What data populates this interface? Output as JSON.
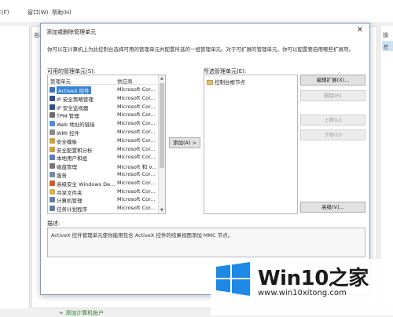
{
  "menubar": {
    "items": [
      "文件(F)",
      "操作(A)",
      "查看(V)",
      "收藏夹(O)",
      "窗口(W)",
      "帮助(H)"
    ]
  },
  "background": {
    "mid_label": "名称",
    "right_label": "操",
    "right_tab": "控",
    "bottom_link": "+ 添加计算机帐户"
  },
  "dialog": {
    "title": "添加或删除管理单元",
    "description": "你可以在计算机上为此控制台选择可用的管理单元并配置所选的一组管理单元。对于可扩展的管理单元，你可以配置要启用哪些扩展项。",
    "available_label": "可用的管理单元(S):",
    "selected_label": "所选管理单元(E):",
    "columns": {
      "name": "管理单元",
      "vendor": "供应商"
    },
    "snapins": [
      {
        "name": "ActiveX 控件",
        "vendor": "Microsoft Cor...",
        "icon_color": "#3a6fc4",
        "selected": true
      },
      {
        "name": "IP 安全策略管理",
        "vendor": "Microsoft Cor...",
        "icon_color": "#2f4f8a",
        "selected": false
      },
      {
        "name": "IP 安全监视器",
        "vendor": "Microsoft Cor...",
        "icon_color": "#2f4f8a",
        "selected": false
      },
      {
        "name": "TPM 管理",
        "vendor": "Microsoft Cor...",
        "icon_color": "#6b6b6b",
        "selected": false
      },
      {
        "name": "Web 地址的链接",
        "vendor": "Microsoft Cor...",
        "icon_color": "#4a90d9",
        "selected": false
      },
      {
        "name": "WMI 控件",
        "vendor": "Microsoft Cor...",
        "icon_color": "#8a8a8a",
        "selected": false
      },
      {
        "name": "安全模板",
        "vendor": "Microsoft Cor...",
        "icon_color": "#c9a23a",
        "selected": false
      },
      {
        "name": "安全配置和分析",
        "vendor": "Microsoft Cor...",
        "icon_color": "#c9a23a",
        "selected": false
      },
      {
        "name": "本地用户和组",
        "vendor": "Microsoft Cor...",
        "icon_color": "#5a7fb5",
        "selected": false
      },
      {
        "name": "磁盘管理",
        "vendor": "Microsoft 和 V...",
        "icon_color": "#777777",
        "selected": false
      },
      {
        "name": "服务",
        "vendor": "Microsoft Cor...",
        "icon_color": "#6f8fb0",
        "selected": false
      },
      {
        "name": "高级安全 Windows De...",
        "vendor": "Microsoft Cor...",
        "icon_color": "#d05a2a",
        "selected": false
      },
      {
        "name": "共享文件夹",
        "vendor": "Microsoft Cor...",
        "icon_color": "#d9b24a",
        "selected": false
      },
      {
        "name": "计算机管理",
        "vendor": "Microsoft Cor...",
        "icon_color": "#5c7ea8",
        "selected": false
      },
      {
        "name": "任务计划程序",
        "vendor": "Microsoft Cor...",
        "icon_color": "#5c7ea8",
        "selected": false
      }
    ],
    "add_button": "添加(A) >",
    "selected_items": [
      "控制台根节点"
    ],
    "edit_extensions_button": "编辑扩展(X)...",
    "delete_button": "删除(R)",
    "move_up_button": "上移(U)",
    "move_down_button": "下移(D)",
    "advanced_button": "高级(V)...",
    "description_label": "描述:",
    "description_text": "ActiveX 控件管理单元使你能用包含 ActiveX 控件的结果视图添加 MMC 节点。"
  },
  "watermark": {
    "title_latin": "Win10",
    "title_cjk": "之家",
    "url": "www.win10xitong.com",
    "logo_color": "#1e88e5"
  }
}
